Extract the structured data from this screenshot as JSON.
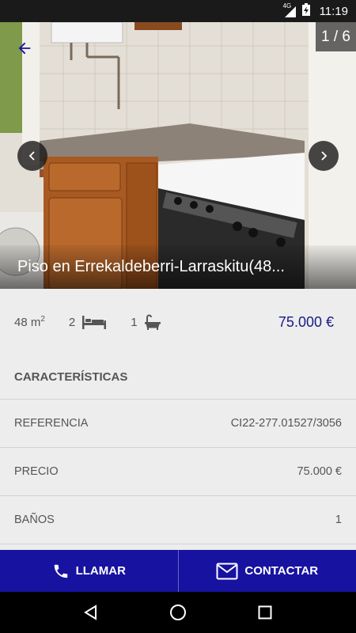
{
  "status_bar": {
    "network": "4G",
    "time": "11:19"
  },
  "gallery": {
    "counter": "1 / 6",
    "title": "Piso en Errekaldeberri-Larraskitu(48..."
  },
  "summary": {
    "area_value": "48 m",
    "area_sup": "2",
    "bedrooms": "2",
    "bathrooms": "1",
    "price": "75.000 €"
  },
  "features": {
    "title": "CARACTERÍSTICAS",
    "rows": [
      {
        "label": "REFERENCIA",
        "value": "CI22-277.01527/3056"
      },
      {
        "label": "PRECIO",
        "value": "75.000 €"
      },
      {
        "label": "BAÑOS",
        "value": "1"
      }
    ]
  },
  "actions": {
    "call_label": "LLAMAR",
    "contact_label": "CONTACTAR"
  },
  "colors": {
    "accent": "#1712a0",
    "price": "#1a1a86"
  }
}
